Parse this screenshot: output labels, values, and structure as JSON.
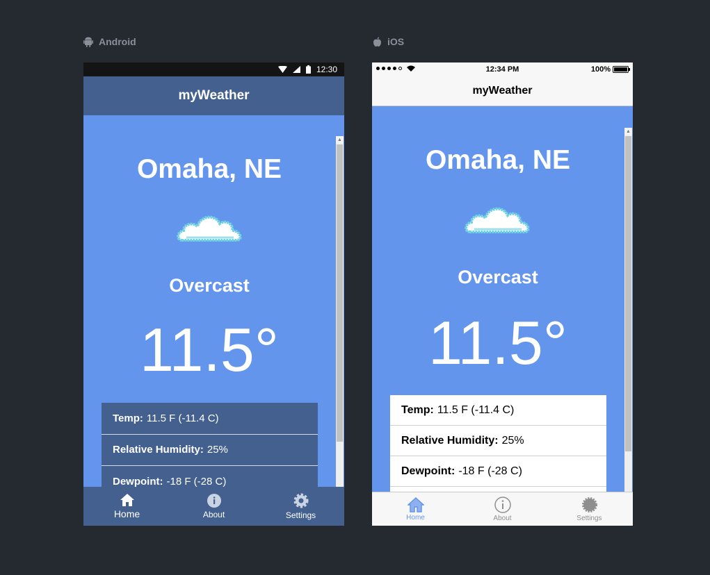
{
  "platforms": {
    "android": "Android",
    "ios": "iOS"
  },
  "android": {
    "status_time": "12:30",
    "title": "myWeather",
    "tabs": [
      {
        "label": "Home",
        "icon": "home-icon"
      },
      {
        "label": "About",
        "icon": "info-icon"
      },
      {
        "label": "Settings",
        "icon": "gear-icon"
      }
    ]
  },
  "ios": {
    "status_time": "12:34 PM",
    "battery": "100%",
    "title": "myWeather",
    "tabs": [
      {
        "label": "Home",
        "icon": "home-icon"
      },
      {
        "label": "About",
        "icon": "info-icon"
      },
      {
        "label": "Settings",
        "icon": "gear-icon"
      }
    ]
  },
  "weather": {
    "city": "Omaha, NE",
    "condition": "Overcast",
    "temperature": "11.5°",
    "details": [
      {
        "label": "Temp:",
        "value": "11.5 F (-11.4 C)"
      },
      {
        "label": "Relative Humidity:",
        "value": "25%"
      },
      {
        "label": "Dewpoint:",
        "value": "-18 F (-28 C)"
      }
    ]
  },
  "colors": {
    "background": "#252a31",
    "content": "#6495ed",
    "android_bar": "#43608f",
    "ios_accent": "#6495ed"
  }
}
